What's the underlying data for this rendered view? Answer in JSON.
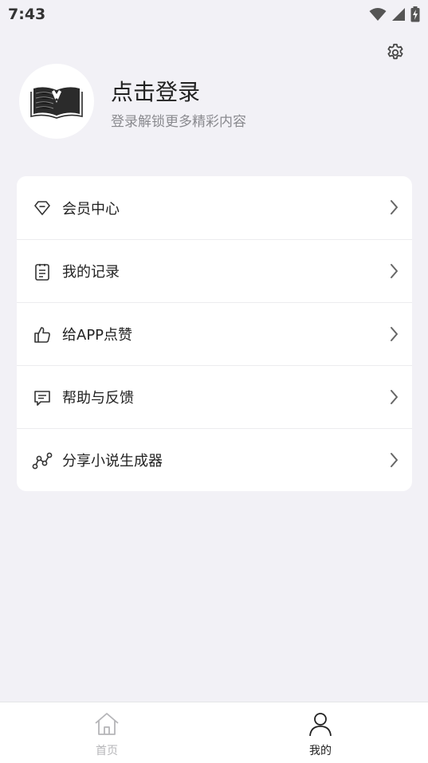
{
  "status_bar": {
    "time": "7:43",
    "icons": [
      "wifi-icon",
      "signal-icon",
      "battery-charging-icon"
    ]
  },
  "header": {
    "settings_icon": "gear-icon"
  },
  "profile": {
    "avatar_icon": "open-book-pen-logo",
    "title": "点击登录",
    "subtitle": "登录解锁更多精彩内容"
  },
  "menu": {
    "items": [
      {
        "label": "会员中心",
        "icon": "diamond-icon"
      },
      {
        "label": "我的记录",
        "icon": "document-list-icon"
      },
      {
        "label": "给APP点赞",
        "icon": "thumbs-up-icon"
      },
      {
        "label": "帮助与反馈",
        "icon": "message-icon"
      },
      {
        "label": "分享小说生成器",
        "icon": "share-nodes-icon"
      }
    ]
  },
  "tabbar": {
    "tabs": [
      {
        "label": "首页",
        "icon": "home-icon",
        "active": false
      },
      {
        "label": "我的",
        "icon": "person-icon",
        "active": true
      }
    ],
    "colors": {
      "active": "#222222",
      "inactive": "#b5b5b8"
    }
  }
}
